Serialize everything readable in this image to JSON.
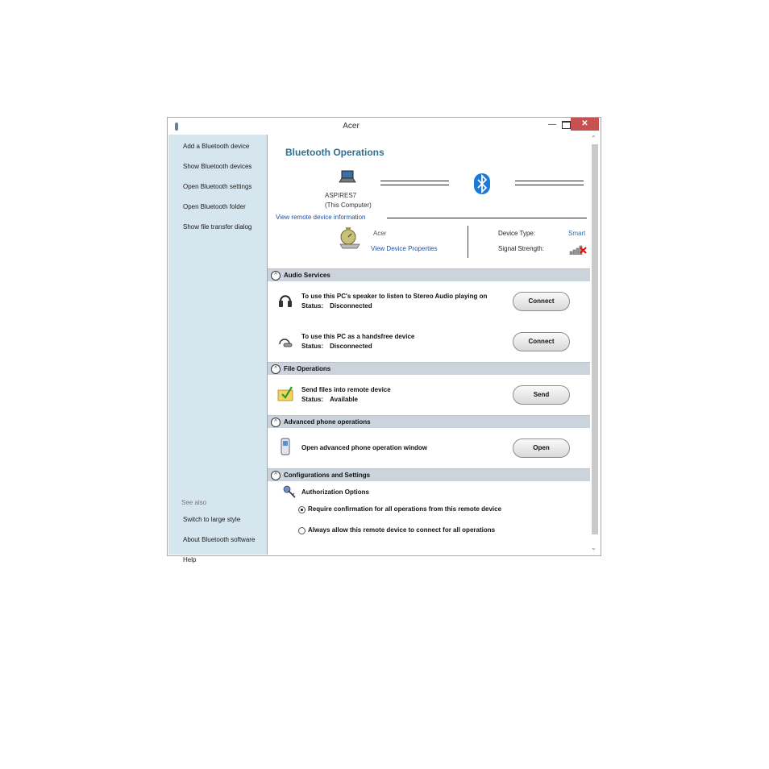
{
  "window": {
    "title": "Acer"
  },
  "sidebar": {
    "items": [
      {
        "label": "Add a Bluetooth device"
      },
      {
        "label": "Show Bluetooth devices"
      },
      {
        "label": "Open Bluetooth settings"
      },
      {
        "label": "Open Bluetooth folder"
      },
      {
        "label": "Show file transfer dialog"
      }
    ],
    "see_also_label": "See also",
    "see_also": [
      {
        "label": "Switch to large style"
      },
      {
        "label": "About Bluetooth software"
      },
      {
        "label": "Help"
      }
    ]
  },
  "main": {
    "title": "Bluetooth Operations",
    "computer": {
      "name": "ASPIRES7",
      "subtitle": "(This Computer)"
    },
    "view_remote_link": "View remote device information",
    "device": {
      "name": "Acer",
      "properties_link": "View Device Properties",
      "type_label": "Device Type:",
      "type_value": "Smart",
      "signal_label": "Signal Strength:"
    },
    "sections": {
      "audio": {
        "label": "Audio Services",
        "rows": [
          {
            "title": "To use this PC's speaker to listen to Stereo Audio playing on",
            "status_label": "Status:",
            "status_value": "Disconnected",
            "button": "Connect"
          },
          {
            "title": "To use this PC as a handsfree device",
            "status_label": "Status:",
            "status_value": "Disconnected",
            "button": "Connect"
          }
        ]
      },
      "file": {
        "label": "File Operations",
        "rows": [
          {
            "title": "Send files into remote device",
            "status_label": "Status:",
            "status_value": "Available",
            "button": "Send"
          }
        ]
      },
      "phone": {
        "label": "Advanced phone operations",
        "rows": [
          {
            "title": "Open advanced phone operation window",
            "button": "Open"
          }
        ]
      },
      "config": {
        "label": "Configurations and Settings",
        "auth_title": "Authorization Options",
        "options": [
          {
            "label": "Require confirmation for all operations from this remote device",
            "selected": true
          },
          {
            "label": "Always allow this remote device to connect for all operations",
            "selected": false
          }
        ]
      }
    }
  }
}
